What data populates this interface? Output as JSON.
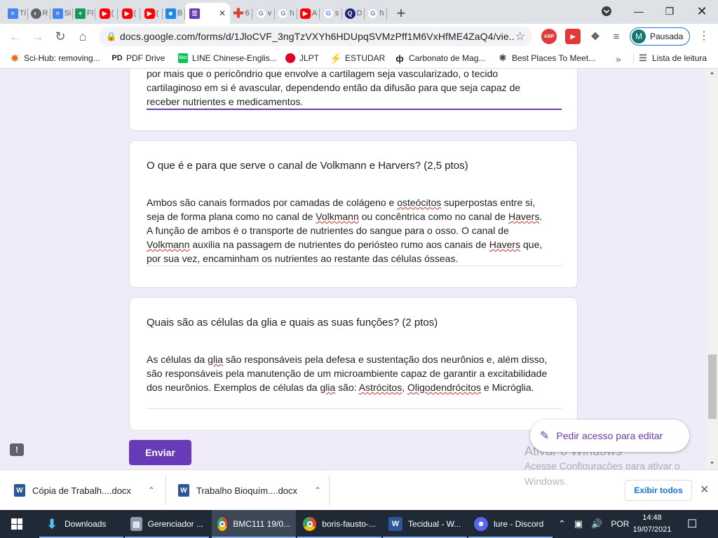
{
  "browser": {
    "tabs": [
      {
        "label": "Tí",
        "icon": "docs-icon"
      },
      {
        "label": "R",
        "icon": "globe-icon"
      },
      {
        "label": "Si",
        "icon": "docs-icon"
      },
      {
        "label": "Fl",
        "icon": "sheets-icon"
      },
      {
        "label": "(",
        "icon": "youtube-icon"
      },
      {
        "label": "(",
        "icon": "youtube-icon"
      },
      {
        "label": "(",
        "icon": "youtube-icon"
      },
      {
        "label": "B",
        "icon": "classroom-icon"
      },
      {
        "label": "",
        "icon": "forms-icon",
        "active": true
      },
      {
        "label": "6",
        "icon": "red-cross-icon"
      },
      {
        "label": "v",
        "icon": "google-icon"
      },
      {
        "label": "h",
        "icon": "google-icon"
      },
      {
        "label": "A",
        "icon": "youtube-icon"
      },
      {
        "label": "s",
        "icon": "google-icon"
      },
      {
        "label": "D",
        "icon": "quizlet-icon"
      },
      {
        "label": "h",
        "icon": "google-icon"
      }
    ],
    "url": "docs.google.com/forms/d/1JloCVF_3ngTzVXYh6HDUpqSVMzPff1M6VxHfME4ZaQ4/vie...",
    "profile_initial": "M",
    "profile_label": "Pausada",
    "extensions": [
      "ABP",
      "▶"
    ],
    "bookmarks": [
      {
        "label": "Sci-Hub: removing...",
        "icon": "scihub-icon"
      },
      {
        "label": "PDF Drive",
        "icon": "pdfdrive-icon"
      },
      {
        "label": "LINE Chinese-Englis...",
        "icon": "line-dict-icon"
      },
      {
        "label": "JLPT",
        "icon": "jlpt-icon"
      },
      {
        "label": "ESTUDAR",
        "icon": "estudar-icon"
      },
      {
        "label": "Carbonato de Mag...",
        "icon": "carbonato-icon"
      },
      {
        "label": "Best Places To Meet...",
        "icon": "bestplaces-icon"
      }
    ],
    "bookmarks_overflow": "»",
    "reading_list": "Lista de leitura"
  },
  "form": {
    "prev_answer": {
      "lines": [
        "por mais que o pericôndrio que envolve a cartilagem seja vascularizado, o tecido",
        "cartilaginoso em si é avascular, dependendo então da difusão para que seja capaz de",
        "receber nutrientes e medicamentos."
      ]
    },
    "q1": {
      "title": "O que é e para que serve o canal de Volkmann e Harvers? (2,5 ptos)",
      "answer": [
        [
          "Ambos são canais formados por camadas de colágeno e ",
          {
            "sq": "osteócitos"
          },
          " superpostas entre si,"
        ],
        [
          "seja de forma plana como no canal de ",
          {
            "sq": "Volkmann"
          },
          " ou concêntrica como no canal de ",
          {
            "sq": "Havers"
          },
          "."
        ],
        [
          "A função de ambos é o transporte de nutrientes do sangue para o osso. O canal de"
        ],
        [
          {
            "sq": "Volkmann"
          },
          " auxilia na passagem de nutrientes do periósteo rumo aos canais de ",
          {
            "sq": "Havers"
          },
          " que,"
        ],
        [
          "por sua vez, encaminham os nutrientes ao restante das células ósseas."
        ]
      ]
    },
    "q2": {
      "title": "Quais são as células da glia e quais as suas funções? (2 ptos)",
      "answer": [
        [
          "As células da ",
          {
            "sq": "glia"
          },
          " são responsáveis pela defesa e sustentação dos neurônios e, além disso,"
        ],
        [
          "são responsáveis pela manutenção de um microambiente capaz de garantir a excitabilidade"
        ],
        [
          "dos neurônios. Exemplos de células da ",
          {
            "sq": "glia"
          },
          " são: ",
          {
            "sq": "Astrócitos"
          },
          ", ",
          {
            "sq": "Oligodendrócitos"
          },
          " e Micróglia."
        ]
      ]
    },
    "submit_label": "Enviar",
    "edit_access_label": "Pedir acesso para editar"
  },
  "watermark": {
    "title": "Ativar o Windows",
    "line1": "Acesse Configurações para ativar o",
    "line2": "Windows."
  },
  "downloads": {
    "items": [
      {
        "name": "Cópia de Trabalh....docx"
      },
      {
        "name": "Trabalho Bioquím....docx"
      }
    ],
    "show_all": "Exibir todos"
  },
  "taskbar": {
    "items": [
      {
        "label": "Downloads",
        "icon": "folder-download-icon"
      },
      {
        "label": "Gerenciador ...",
        "icon": "task-manager-icon"
      },
      {
        "label": "BMC111 19/0...",
        "icon": "chrome-icon",
        "active": true
      },
      {
        "label": "boris-fausto-...",
        "icon": "chrome-icon"
      },
      {
        "label": "Tecidual - W...",
        "icon": "word-icon"
      },
      {
        "label": "lure - Discord",
        "icon": "discord-icon"
      }
    ],
    "language": "POR",
    "time": "14:48",
    "date": "19/07/2021"
  },
  "colors": {
    "forms_accent": "#673ab7",
    "page_bg": "#f0ebf8",
    "taskbar_bg": "#1f2a36",
    "spellcheck": "#d93025"
  }
}
